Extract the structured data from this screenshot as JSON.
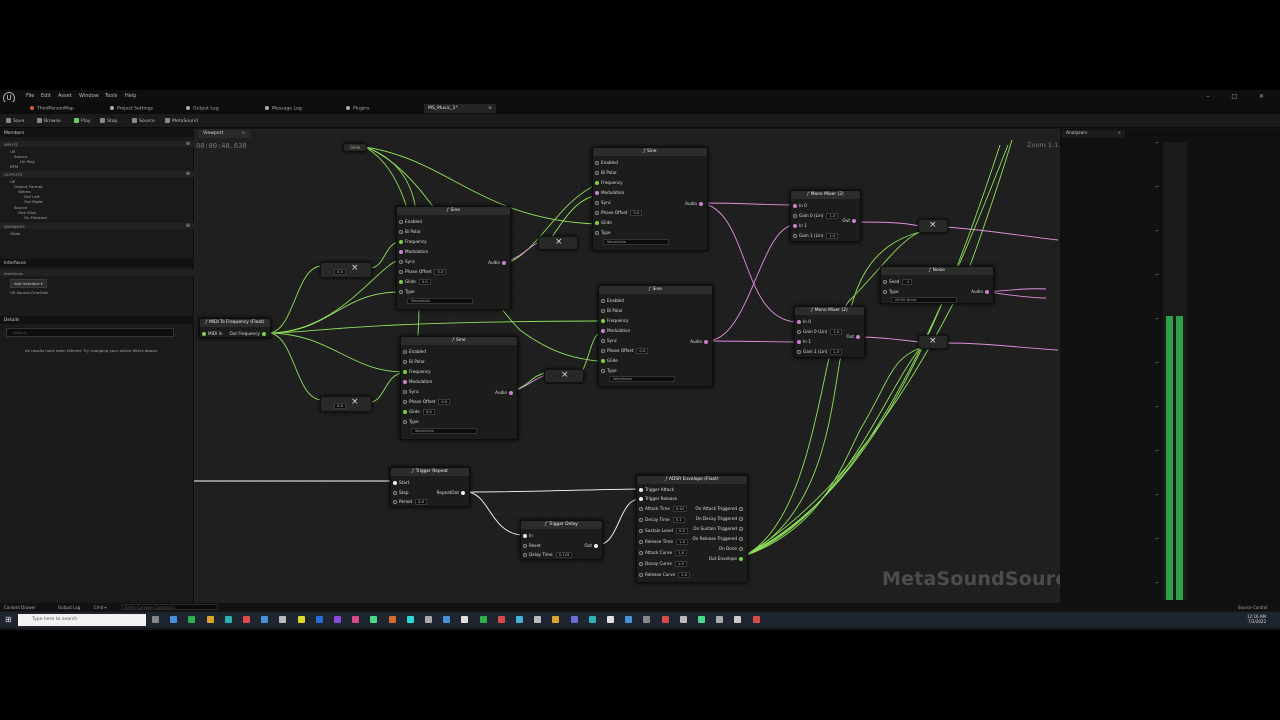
{
  "menubar": {
    "logo": "U",
    "items": [
      "File",
      "Edit",
      "Asset",
      "Window",
      "Tools",
      "Help"
    ],
    "window_controls": "–  □  ✕"
  },
  "tabs": [
    {
      "label": "ThirdPersonMap"
    },
    {
      "label": "Project Settings"
    },
    {
      "label": "Output Log"
    },
    {
      "label": "Message Log"
    },
    {
      "label": "Plugins"
    },
    {
      "label": "MS_Music_1*",
      "close": "×"
    }
  ],
  "toolbar": {
    "save": "Save",
    "browse": "Browse",
    "play": "Play",
    "stop": "Stop",
    "source": "Source",
    "metasound": "MetaSound"
  },
  "members": {
    "panel_title": "Members",
    "inputs_header": "INPUTS",
    "inputs_tree": [
      "UE",
      "Source",
      "On Play",
      "BPM"
    ],
    "outputs_header": "OUTPUTS",
    "outputs_tree": [
      "UE",
      "Output Format",
      "Stereo",
      "Out Left",
      "Out Right",
      "Source",
      "One Shot",
      "On Finished"
    ],
    "variables_header": "VARIABLES",
    "variables_tree": [
      "Glide"
    ]
  },
  "interfaces": {
    "panel_title": "Interfaces",
    "header": "Interfaces",
    "add_button": "Add Interface ▾",
    "item": "UE.Source.OneShot"
  },
  "details": {
    "panel_title": "Details",
    "search_placeholder": "Search",
    "empty_message": "All results have been filtered. Try changing your active filters above."
  },
  "viewport": {
    "tab_label": "Viewport",
    "tab_close": "×",
    "timer": "00:00:48.630",
    "zoom": "Zoom 1:1",
    "watermark": "MetaSoundSource"
  },
  "nodes": {
    "glide_getter": {
      "label": "Glide"
    },
    "midi_to_freq": {
      "title": "MIDI To Frequency (Float)",
      "in": "MIDI In",
      "out": "Out Frequency"
    },
    "mul_top": {
      "value": "0.5"
    },
    "mul_bottom": {
      "value": "4.0"
    },
    "sine_common": {
      "title": "Sine",
      "enabled": "Enabled",
      "bipolar": "Bi Polar",
      "frequency": "Frequency",
      "modulation": "Modulation",
      "sync": "Sync",
      "phase_offset": "Phase Offset",
      "phase_offset_val": "0.0",
      "glide": "Glide",
      "glide_val": "0.0",
      "type": "Type",
      "type_val": "Wavetable",
      "audio": "Audio"
    },
    "mono_mixer": {
      "title": "Mono Mixer (2)",
      "in0": "In 0",
      "in1": "In 1",
      "gain0": "Gain 0 (Lin)",
      "gain1": "Gain 1 (Lin)",
      "gain_val": "1.0",
      "out": "Out"
    },
    "noise": {
      "title": "Noise",
      "seed": "Seed",
      "seed_val": "-1",
      "type": "Type",
      "type_val": "White Noise",
      "audio": "Audio"
    },
    "trigger_repeat": {
      "title": "Trigger Repeat",
      "start": "Start",
      "stop": "Stop",
      "period": "Period",
      "period_val": "4.0",
      "out": "RepeatOut"
    },
    "trigger_delay": {
      "title": "Trigger Delay",
      "in": "In",
      "reset": "Reset",
      "delay": "Delay Time",
      "delay_val": "0.125",
      "out": "Out"
    },
    "adsr": {
      "title": "ADSR Envelope (Float)",
      "trigger_attack": "Trigger Attack",
      "trigger_release": "Trigger Release",
      "attack_time": "Attack Time",
      "attack_val": "0.01",
      "decay_time": "Decay Time",
      "decay_val": "0.1",
      "sustain": "Sustain Level",
      "sustain_val": "0.5",
      "release_time": "Release Time",
      "release_val": "1.0",
      "attack_curve": "Attack Curve",
      "attack_curve_val": "1.0",
      "decay_curve": "Decay Curve",
      "decay_curve_val": "1.0",
      "release_curve": "Release Curve",
      "release_curve_val": "1.0",
      "on_attack": "On Attack Triggered",
      "on_decay": "On Decay Triggered",
      "on_sustain": "On Sustain Triggered",
      "on_release": "On Release Triggered",
      "on_done": "On Done",
      "out_env": "Out Envelope"
    }
  },
  "analyzer": {
    "tab_label": "Analyzers",
    "close": "×",
    "level": 0.62
  },
  "statusbar": {
    "content_drawer": "Content Drawer",
    "output_log": "Output Log",
    "cmd": "Cmd ▾",
    "cmd_placeholder": "Enter Console Command",
    "source_control": "Source Control"
  },
  "taskbar": {
    "search_placeholder": "Type here to search",
    "time": "12:16 AM",
    "date": "7/3/2022"
  },
  "colors": {
    "float_wire": "#8fe05a",
    "audio_wire": "#e090e0",
    "exec_wire": "#ffffff",
    "meter": "#2ea04a"
  }
}
